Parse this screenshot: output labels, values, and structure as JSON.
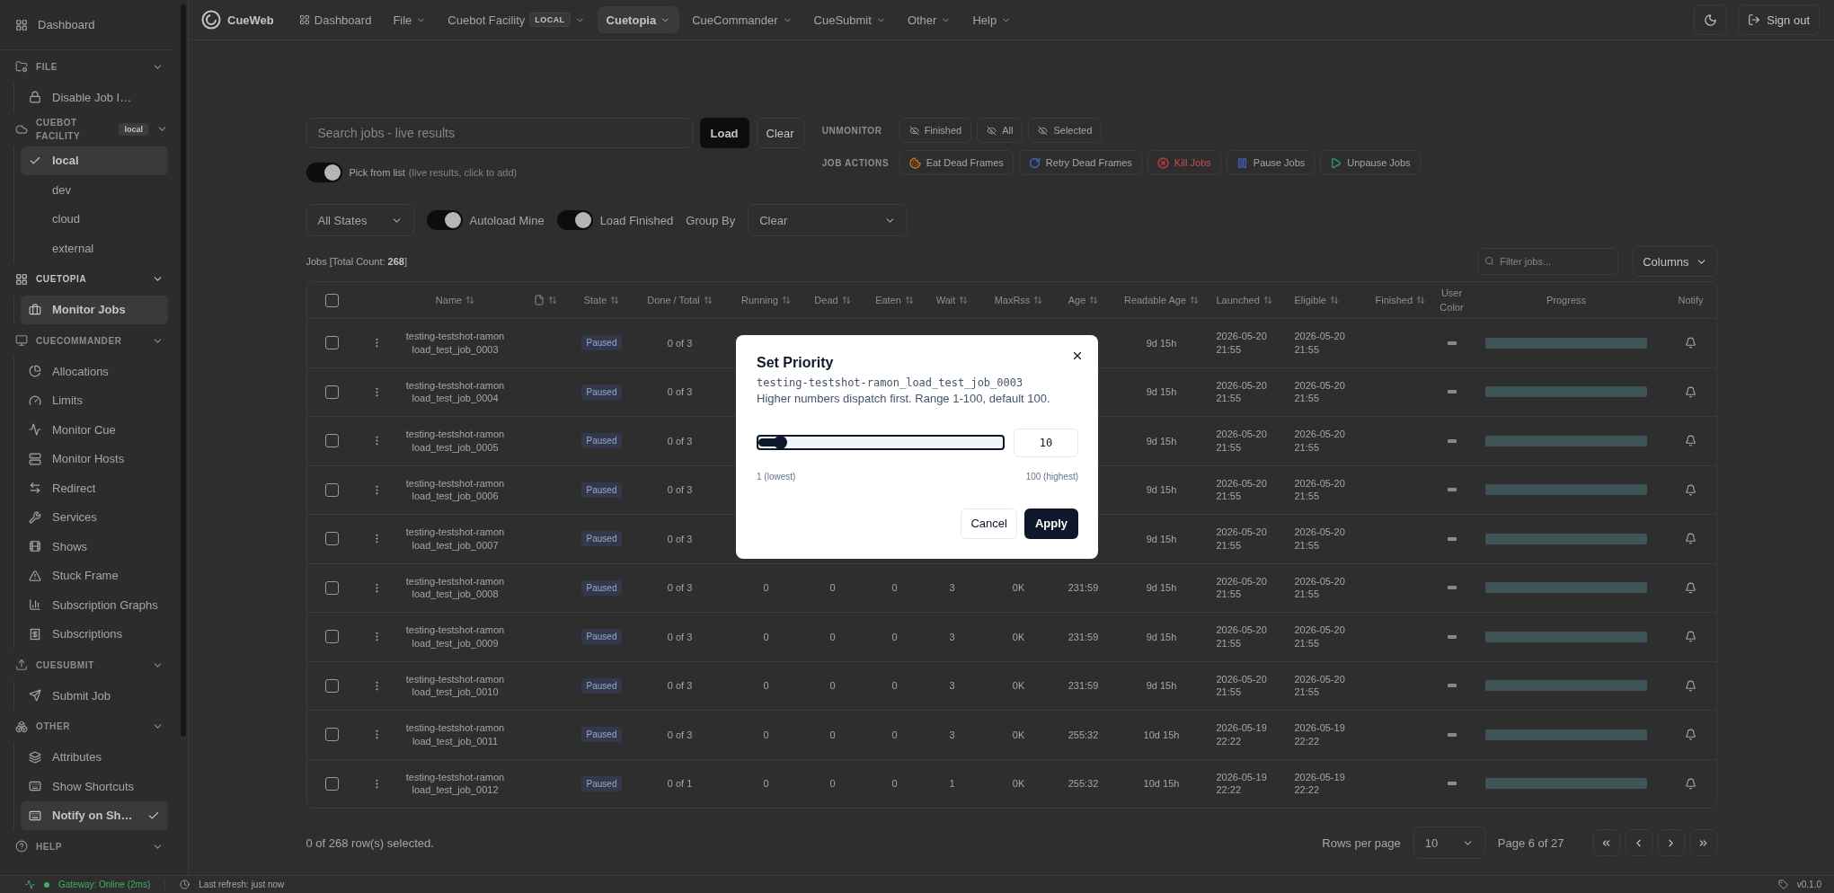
{
  "nav": {
    "brand": "CueWeb",
    "items": [
      {
        "label": "Dashboard",
        "kind": "link",
        "selected": false
      },
      {
        "label": "File",
        "kind": "menu",
        "selected": false
      },
      {
        "label": "Cuebot Facility",
        "kind": "menu",
        "selected": false,
        "badge": "LOCAL"
      },
      {
        "label": "Cuetopia",
        "kind": "menu",
        "selected": true
      },
      {
        "label": "CueCommander",
        "kind": "menu",
        "selected": false
      },
      {
        "label": "CueSubmit",
        "kind": "menu",
        "selected": false
      },
      {
        "label": "Other",
        "kind": "menu",
        "selected": false
      },
      {
        "label": "Help",
        "kind": "menu",
        "selected": false
      }
    ],
    "sign_out": "Sign out"
  },
  "sidebar": {
    "dashboard": "Dashboard",
    "sections": [
      {
        "title": "FILE",
        "active": false,
        "expanded": true,
        "kind": "links",
        "items": [
          {
            "label": "Disable Job I…",
            "kind": "link",
            "selected": false
          }
        ]
      },
      {
        "title": "CUEBOT FACILITY",
        "badge": "local",
        "active": false,
        "expanded": true,
        "kind": "choice",
        "items": [
          {
            "label": "local",
            "selected": true
          },
          {
            "label": "dev",
            "selected": false
          },
          {
            "label": "cloud",
            "selected": false
          },
          {
            "label": "external",
            "selected": false
          }
        ]
      },
      {
        "title": "CUETOPIA",
        "active": true,
        "expanded": true,
        "kind": "links",
        "items": [
          {
            "label": "Monitor Jobs",
            "kind": "link",
            "selected": true
          }
        ]
      },
      {
        "title": "CUECOMMANDER",
        "active": false,
        "expanded": true,
        "kind": "links",
        "items": [
          {
            "label": "Allocations",
            "kind": "link",
            "selected": false
          },
          {
            "label": "Limits",
            "kind": "link",
            "selected": false
          },
          {
            "label": "Monitor Cue",
            "kind": "link",
            "selected": false
          },
          {
            "label": "Monitor Hosts",
            "kind": "link",
            "selected": false
          },
          {
            "label": "Redirect",
            "kind": "link",
            "selected": false
          },
          {
            "label": "Services",
            "kind": "link",
            "selected": false
          },
          {
            "label": "Shows",
            "kind": "link",
            "selected": false
          },
          {
            "label": "Stuck Frame",
            "kind": "link",
            "selected": false
          },
          {
            "label": "Subscription Graphs",
            "kind": "link",
            "selected": false
          },
          {
            "label": "Subscriptions",
            "kind": "link",
            "selected": false
          }
        ]
      },
      {
        "title": "CUESUBMIT",
        "active": false,
        "expanded": true,
        "kind": "links",
        "items": [
          {
            "label": "Submit Job",
            "kind": "link",
            "selected": false
          }
        ]
      },
      {
        "title": "OTHER",
        "active": false,
        "expanded": true,
        "kind": "links",
        "items": [
          {
            "label": "Attributes",
            "kind": "link",
            "selected": false
          },
          {
            "label": "Show Shortcuts",
            "kind": "link",
            "selected": false
          },
          {
            "label": "Notify on Sh…",
            "kind": "toggle",
            "selected": true,
            "checked": true
          }
        ]
      },
      {
        "title": "HELP",
        "active": false,
        "expanded": true
      }
    ]
  },
  "search": {
    "placeholder": "Search jobs - live results",
    "load": "Load",
    "clear": "Clear",
    "pick_from_list": {
      "label": "Pick from list",
      "hint": "(live results, click to add)",
      "on": true
    }
  },
  "unmonitor": {
    "label": "UNMONITOR",
    "buttons": [
      "Finished",
      "All",
      "Selected"
    ]
  },
  "job_actions": {
    "label": "JOB ACTIONS",
    "buttons": [
      {
        "label": "Eat Dead Frames",
        "color": "#b86a1c",
        "destructive": false
      },
      {
        "label": "Retry Dead Frames",
        "color": "#3a66b0",
        "destructive": false
      },
      {
        "label": "Kill Jobs",
        "color": "#b03a3a",
        "destructive": true
      },
      {
        "label": "Pause Jobs",
        "color": "#3b5ba5",
        "destructive": false
      },
      {
        "label": "Unpause Jobs",
        "color": "#2f8a5e",
        "destructive": false
      }
    ]
  },
  "filters": {
    "state": "All States",
    "autoload_mine": {
      "label": "Autoload Mine",
      "on": true
    },
    "load_finished": {
      "label": "Load Finished",
      "on": true
    },
    "group_by_label": "Group By",
    "group_by": "Clear"
  },
  "jobs_count": "Jobs [Total Count: **268**]",
  "filter_jobs": {
    "placeholder": "Filter jobs..."
  },
  "columns_button": "Columns",
  "table": {
    "all_selected": false,
    "columns": [
      {
        "kind": "text",
        "label": "Name",
        "sortable": true
      },
      {
        "kind": "icon",
        "sortable": true
      },
      {
        "kind": "text",
        "label": "State",
        "sortable": true
      },
      {
        "kind": "text",
        "label": "Done / Total",
        "sortable": true
      },
      {
        "kind": "text",
        "label": "Running",
        "sortable": true
      },
      {
        "kind": "text",
        "label": "Dead",
        "sortable": true
      },
      {
        "kind": "text",
        "label": "Eaten",
        "sortable": true
      },
      {
        "kind": "text",
        "label": "Wait",
        "sortable": true
      },
      {
        "kind": "text",
        "label": "MaxRss",
        "sortable": true
      },
      {
        "kind": "text",
        "label": "Age",
        "sortable": true
      },
      {
        "kind": "text",
        "label": "Readable Age",
        "sortable": true
      },
      {
        "kind": "text",
        "label": "Launched",
        "sortable": true
      },
      {
        "kind": "text",
        "label": "Eligible",
        "sortable": true
      },
      {
        "kind": "text",
        "label": "Finished",
        "sortable": true
      },
      {
        "kind": "text",
        "label": "User Color",
        "sortable": false
      },
      {
        "kind": "text",
        "label": "Progress",
        "sortable": false
      },
      {
        "kind": "text",
        "label": "Notify",
        "sortable": false
      }
    ],
    "rows": [
      {
        "selected": false,
        "name": "testing-testshot-ramon load_test_job_0003",
        "state": "Paused",
        "done_total": "0 of 3",
        "readable_age": "9d 15h",
        "launched": "2026-05-20 21:55",
        "eligible": "2026-05-20 21:55",
        "level": 1
      },
      {
        "selected": false,
        "name": "testing-testshot-ramon load_test_job_0004",
        "state": "Paused",
        "done_total": "0 of 3",
        "readable_age": "9d 15h",
        "launched": "2026-05-20 21:55",
        "eligible": "2026-05-20 21:55",
        "level": 1
      },
      {
        "selected": false,
        "name": "testing-testshot-ramon load_test_job_0005",
        "state": "Paused",
        "done_total": "0 of 3",
        "readable_age": "9d 15h",
        "launched": "2026-05-20 21:55",
        "eligible": "2026-05-20 21:55",
        "level": 1
      },
      {
        "selected": false,
        "name": "testing-testshot-ramon load_test_job_0006",
        "state": "Paused",
        "done_total": "0 of 3",
        "readable_age": "9d 15h",
        "launched": "2026-05-20 21:55",
        "eligible": "2026-05-20 21:55",
        "level": 1
      },
      {
        "selected": false,
        "name": "testing-testshot-ramon load_test_job_0007",
        "state": "Paused",
        "done_total": "0 of 3",
        "readable_age": "9d 15h",
        "launched": "2026-05-20 21:55",
        "eligible": "2026-05-20 21:55",
        "level": 1
      },
      {
        "selected": false,
        "name": "testing-testshot-ramon load_test_job_0008",
        "state": "Paused",
        "done_total": "0 of 3",
        "running": "0",
        "dead": "0",
        "eaten": "0",
        "wait": "3",
        "max_rss": "0K",
        "age": "231:59",
        "readable_age": "9d 15h",
        "launched": "2026-05-20 21:55",
        "eligible": "2026-05-20 21:55",
        "level": 1
      },
      {
        "selected": false,
        "name": "testing-testshot-ramon load_test_job_0009",
        "state": "Paused",
        "done_total": "0 of 3",
        "running": "0",
        "dead": "0",
        "eaten": "0",
        "wait": "3",
        "max_rss": "0K",
        "age": "231:59",
        "readable_age": "9d 15h",
        "launched": "2026-05-20 21:55",
        "eligible": "2026-05-20 21:55",
        "level": 1
      },
      {
        "selected": false,
        "name": "testing-testshot-ramon load_test_job_0010",
        "state": "Paused",
        "done_total": "0 of 3",
        "running": "0",
        "dead": "0",
        "eaten": "0",
        "wait": "3",
        "max_rss": "0K",
        "age": "231:59",
        "readable_age": "9d 15h",
        "launched": "2026-05-20 21:55",
        "eligible": "2026-05-20 21:55",
        "level": 1
      },
      {
        "selected": false,
        "name": "testing-testshot-ramon load_test_job_0011",
        "state": "Paused",
        "done_total": "0 of 3",
        "running": "0",
        "dead": "0",
        "eaten": "0",
        "wait": "3",
        "max_rss": "0K",
        "age": "255:32",
        "readable_age": "10d 15h",
        "launched": "2026-05-19 22:22",
        "eligible": "2026-05-19 22:22",
        "level": 1
      },
      {
        "selected": false,
        "name": "testing-testshot-ramon load_test_job_0012",
        "state": "Paused",
        "done_total": "0 of 1",
        "running": "0",
        "dead": "0",
        "eaten": "0",
        "wait": "1",
        "max_rss": "0K",
        "age": "255:32",
        "readable_age": "10d 15h",
        "launched": "2026-05-19 22:22",
        "eligible": "2026-05-19 22:22",
        "level": 1
      }
    ]
  },
  "footer": {
    "selection": "0 of 268 row(s) selected.",
    "rows_per_page_label": "Rows per page",
    "rows_per_page": "10",
    "page": "Page 6 of 27"
  },
  "status_bar": {
    "gateway": "Gateway: Online (2ms)",
    "gateway_online": true,
    "last_refresh": "Last refresh: just now",
    "version": "v0.1.0"
  },
  "dialog": {
    "title": "Set Priority",
    "job": "testing-testshot-ramon_load_test_job_0003",
    "description": "Higher numbers dispatch first. Range 1-100, default 100.",
    "level": 0.09,
    "value": "10",
    "min_label": "1 (lowest)",
    "max_label": "100 (highest)",
    "cancel": "Cancel",
    "apply": "Apply"
  }
}
